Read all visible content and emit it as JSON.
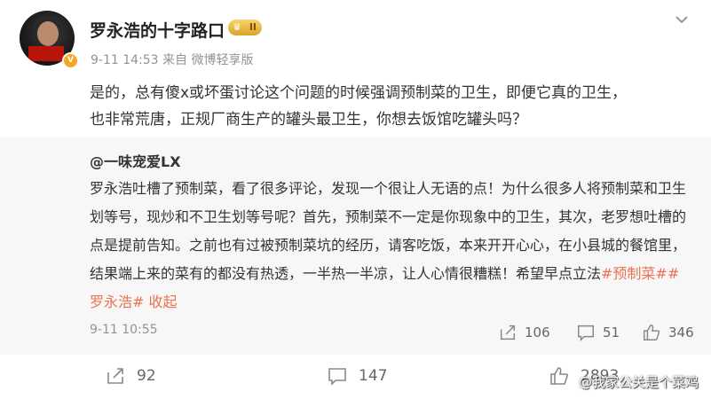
{
  "post": {
    "author": "罗永浩的十字路口",
    "rank_badge": "II",
    "meta": "9-11 14:53 来自 微博轻享版",
    "text_line1": "是的，总有傻x或坏蛋讨论这个问题的时候强调预制菜的卫生，即便它真的卫生，",
    "text_line2": "也非常荒唐，正规厂商生产的罐头最卫生，你想去饭馆吃罐头吗？"
  },
  "quoted": {
    "author": "@一味宠爱LX",
    "text_before_tags": "罗永浩吐槽了预制菜，看了很多评论，发现一个很让人无语的点！为什么很多人将预制菜和卫生划等号，现炒和不卫生划等号呢？首先，预制菜不一定是你现象中的卫生，其次，老罗想吐槽的点是提前告知。之前也有过被预制菜坑的经历，请客吃饭，本来开开心心，在小县城的餐馆里，结果端上来的菜有的都没有热透，一半热一半凉，让人心情很糟糕！希望早点立法",
    "hashtag1": "#预制菜#",
    "hashtag2": "#罗永浩#",
    "collapse": "收起",
    "time": "9-11 10:55",
    "reposts": "106",
    "comments": "51",
    "likes": "346"
  },
  "footer": {
    "reposts": "92",
    "comments": "147",
    "likes": "2893"
  },
  "watermark": "@我家公关是个菜鸡",
  "colors": {
    "accent": "#eb7350",
    "meta": "#939393",
    "quote_bg": "#f7f7f7"
  }
}
